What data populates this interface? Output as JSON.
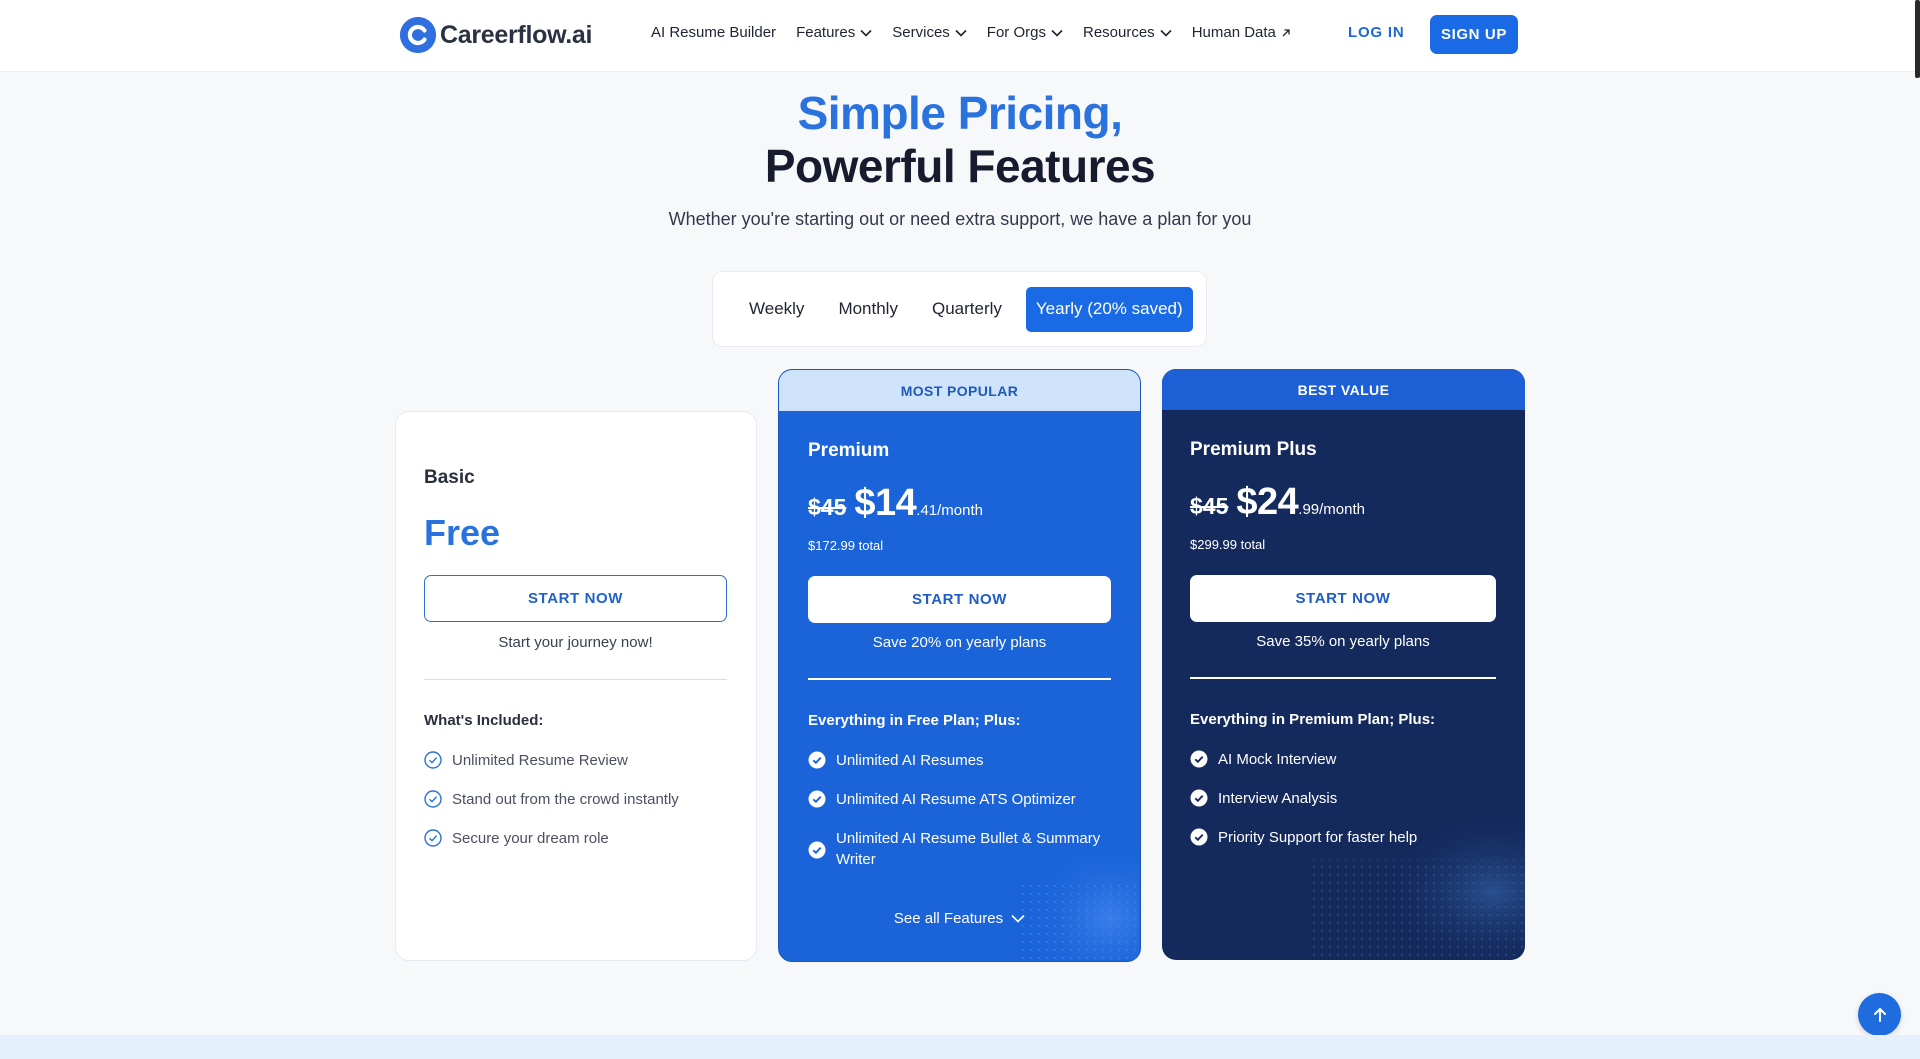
{
  "header": {
    "logo_text": "Careerflow.ai",
    "nav": [
      {
        "label": "AI Resume Builder",
        "icon": "none"
      },
      {
        "label": "Features",
        "icon": "chevron-down-icon"
      },
      {
        "label": "Services",
        "icon": "chevron-down-icon"
      },
      {
        "label": "For Orgs",
        "icon": "chevron-down-icon"
      },
      {
        "label": "Resources",
        "icon": "chevron-down-icon"
      },
      {
        "label": "Human Data",
        "icon": "external-arrow-icon"
      }
    ],
    "login_label": "LOG IN",
    "signup_label": "SIGN UP"
  },
  "hero": {
    "title_line1": "Simple Pricing,",
    "title_line2": "Powerful Features",
    "subtitle": "Whether you're starting out or need extra support, we have a plan for you"
  },
  "billing": {
    "options": [
      "Weekly",
      "Monthly",
      "Quarterly",
      "Yearly (20% saved)"
    ],
    "selected": "Yearly (20% saved)"
  },
  "plans": {
    "basic": {
      "name": "Basic",
      "price": "Free",
      "cta": "START NOW",
      "note": "Start your journey now!",
      "included_heading": "What's Included:",
      "features": [
        "Unlimited Resume Review",
        "Stand out from the crowd instantly",
        "Secure your dream role"
      ]
    },
    "premium": {
      "banner": "MOST POPULAR",
      "name": "Premium",
      "old_price": "$45",
      "price": "$14",
      "price_suffix": ".41/month",
      "total": "$172.99 total",
      "cta": "START NOW",
      "note": "Save 20% on yearly plans",
      "included_heading": "Everything in Free Plan; Plus:",
      "features": [
        "Unlimited AI Resumes",
        "Unlimited AI Resume ATS Optimizer",
        "Unlimited AI Resume Bullet & Summary Writer"
      ],
      "see_all": "See all Features"
    },
    "premium_plus": {
      "banner": "BEST VALUE",
      "name": "Premium Plus",
      "old_price": "$45",
      "price": "$24",
      "price_suffix": ".99/month",
      "total": "$299.99 total",
      "cta": "START NOW",
      "note": "Save 35% on yearly plans",
      "included_heading": "Everything in Premium Plan; Plus:",
      "features": [
        "AI Mock Interview",
        "Interview Analysis",
        "Priority Support for faster help"
      ]
    }
  },
  "colors": {
    "accent": "#1a6ae6",
    "premium_card": "#1a63d9",
    "premium_plus_card": "#14295c",
    "popular_banner": "#cfe3fb"
  }
}
